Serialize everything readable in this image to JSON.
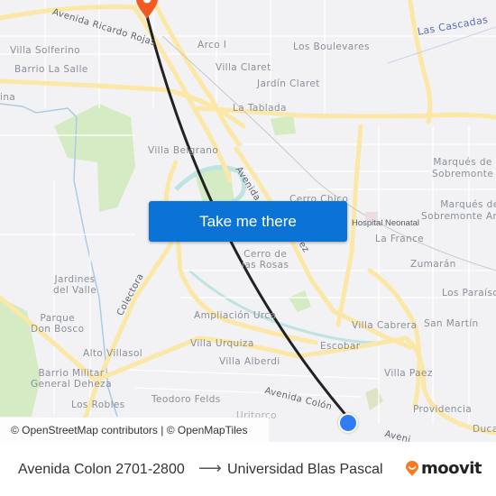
{
  "map": {
    "labels": {
      "road_ricardo_rojas": "Avenida Ricardo Rojas",
      "villa_solferino": "Villa Solferino",
      "barrio_la_salle": "Barrio La Salle",
      "arco_i": "Arco I",
      "los_boulevares": "Los Boulevares",
      "las_cascadas": "Las Cascadas",
      "villa_claret": "Villa Claret",
      "jardin_claret": "Jardín Claret",
      "la_tablada": "La Tablada",
      "ina": "ina",
      "villa_belgrano": "Villa Belgrano",
      "road_avenida": "Avenida",
      "road_ez": "ez",
      "cerro_chico": "Cerro Chico",
      "hospital_neonatal": "Hospital Neonatal",
      "la_france": "La France",
      "marques_sobremonte": [
        "Marqués de",
        "Sobremonte"
      ],
      "marques_sobremonte_an": [
        "Marqués de",
        "Sobremonte An"
      ],
      "cerro_de_las_rosas": [
        "Cerro de",
        "las Rosas"
      ],
      "zumaran": "Zumarán",
      "jardines_del_valle": [
        "Jardines",
        "del Valle"
      ],
      "colectora": "Colectora",
      "los_paraisos": "Los Paraíso",
      "parque_don_bosco": [
        "Parque",
        "Don Bosco"
      ],
      "ampliacion_urca": "Ampliación Urca",
      "villa_cabrera": "Villa Cabrera",
      "san_martin": "San Martín",
      "alto_villasol": "Alto Villasol",
      "villa_urquiza": "Villa Urquiza",
      "escobar": "Escobar",
      "barrio_militar": [
        "Barrio Militar",
        "General Deheza"
      ],
      "villa_alberdi": "Villa Alberdi",
      "villa_paez": "Villa Paez",
      "teodoro_felds": "Teodoro Felds",
      "road_avenida_colon": "Avenida Colón",
      "los_robles": "Los Robles",
      "uritorco": "Uritorco",
      "providencia": "Providencia",
      "ducasse": "Duca",
      "road_avenida_bottom": "Aveni"
    },
    "route_color": "#222222",
    "origin_color": "#2f7cf6",
    "destination_color": "#f25a22"
  },
  "cta": {
    "label": "Take me there"
  },
  "attribution": {
    "text": "© OpenStreetMap contributors | © OpenMapTiles"
  },
  "footer": {
    "from": "Avenida Colon 2701-2800",
    "arrow": "⟶",
    "to": "Universidad Blas Pascal",
    "brand": "moovit",
    "brand_color": "#f47b20"
  }
}
